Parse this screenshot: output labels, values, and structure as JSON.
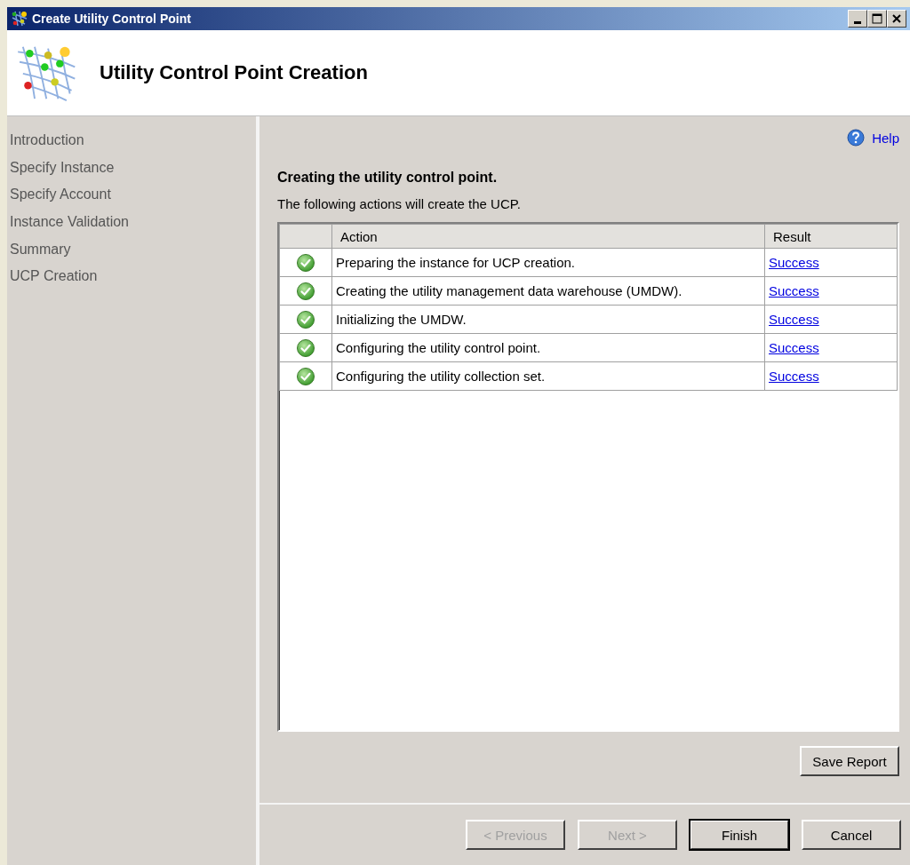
{
  "window": {
    "title": "Create Utility Control Point"
  },
  "header": {
    "title": "Utility Control Point Creation"
  },
  "sidebar": {
    "items": [
      {
        "label": "Introduction"
      },
      {
        "label": "Specify Instance"
      },
      {
        "label": "Specify Account"
      },
      {
        "label": "Instance Validation"
      },
      {
        "label": "Summary"
      },
      {
        "label": "UCP Creation"
      }
    ]
  },
  "help_link": "Help",
  "heading": "Creating the utility control point.",
  "description": "The following actions will create the UCP.",
  "table": {
    "columns": [
      "Action",
      "Result"
    ],
    "rows": [
      {
        "kind": "success",
        "action": "Preparing the instance for UCP creation.",
        "result": "Success"
      },
      {
        "kind": "success",
        "action": "Creating the utility management data warehouse (UMDW).",
        "result": "Success"
      },
      {
        "kind": "success",
        "action": "Initializing the UMDW.",
        "result": "Success"
      },
      {
        "kind": "success",
        "action": "Configuring the utility control point.",
        "result": "Success"
      },
      {
        "kind": "success",
        "action": "Configuring the utility collection set.",
        "result": "Success"
      }
    ]
  },
  "save_report": "Save Report",
  "buttons": [
    {
      "label": "< Previous",
      "disabled": true,
      "default": false
    },
    {
      "label": "Next >",
      "disabled": true,
      "default": false
    },
    {
      "label": "Finish",
      "disabled": false,
      "default": true
    },
    {
      "label": "Cancel",
      "disabled": false,
      "default": false
    }
  ]
}
